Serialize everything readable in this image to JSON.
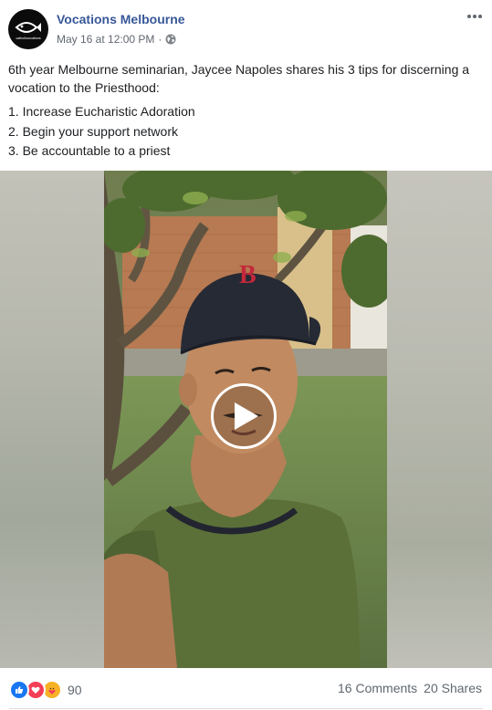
{
  "post": {
    "page_name": "Vocations Melbourne",
    "avatar_text": "catholicvocations",
    "date": "May 16 at 12:00 PM",
    "separator": "·",
    "intro": "6th year Melbourne seminarian, Jaycee Napoles shares his 3 tips for discerning a vocation to the Priesthood:",
    "tips": [
      "1. Increase Eucharistic Adoration",
      "2. Begin your support network",
      "3. Be accountable to a priest"
    ]
  },
  "footer": {
    "reaction_count": "90",
    "comments": "16 Comments",
    "shares": "20 Shares"
  },
  "icons": {
    "more": "more-options-icon",
    "privacy": "globe-icon",
    "play": "play-icon",
    "reactions": [
      "like-reaction-icon",
      "love-reaction-icon",
      "care-reaction-icon"
    ]
  },
  "colors": {
    "link": "#385898",
    "secondary_text": "#616770",
    "like": "#1877f2",
    "love": "#f33e58",
    "care": "#f7b125"
  }
}
